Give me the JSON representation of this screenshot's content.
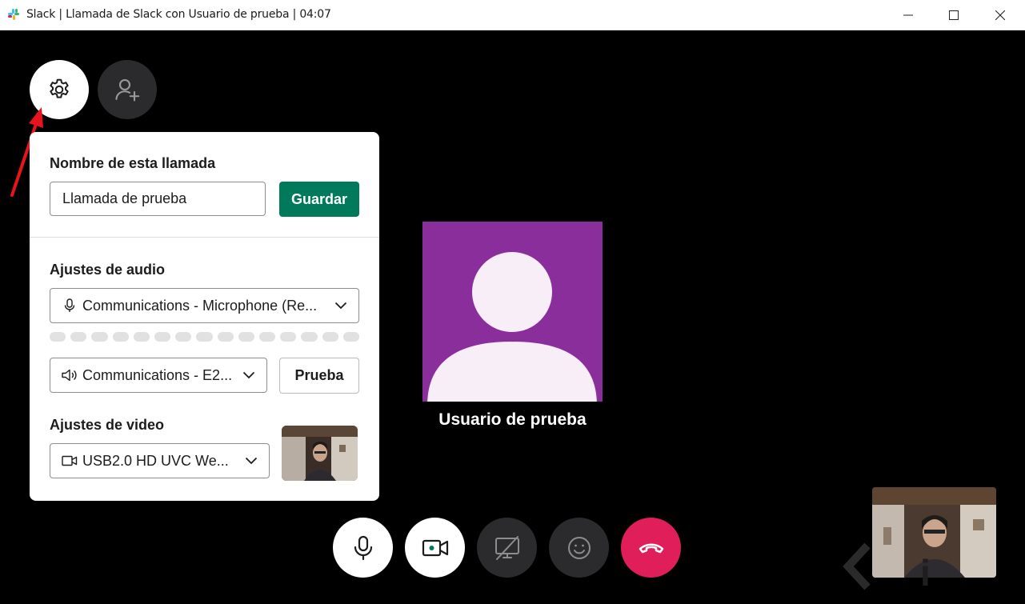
{
  "window": {
    "title": "Slack | Llamada de Slack con Usuario de prueba | 04:07"
  },
  "settings_panel": {
    "call_name_label": "Nombre de esta llamada",
    "call_name_value": "Llamada de prueba",
    "save_label": "Guardar",
    "audio_label": "Ajustes de audio",
    "microphone_value": "Communications - Microphone (Re...",
    "speaker_value": "Communications - E2...",
    "test_label": "Prueba",
    "video_label": "Ajustes de video",
    "camera_value": "USB2.0 HD UVC We..."
  },
  "participant": {
    "name": "Usuario de prueba",
    "avatar_color": "#8a2e9b"
  },
  "colors": {
    "save_button": "#007a5a",
    "hangup_button": "#e01e5a",
    "dark_button": "#2b2b2d"
  },
  "icons": [
    "slack-logo-icon",
    "gear-icon",
    "add-person-icon",
    "microphone-icon",
    "speaker-icon",
    "camera-icon",
    "chevron-down-icon",
    "video-icon",
    "screen-share-off-icon",
    "emoji-icon",
    "hang-up-icon"
  ]
}
